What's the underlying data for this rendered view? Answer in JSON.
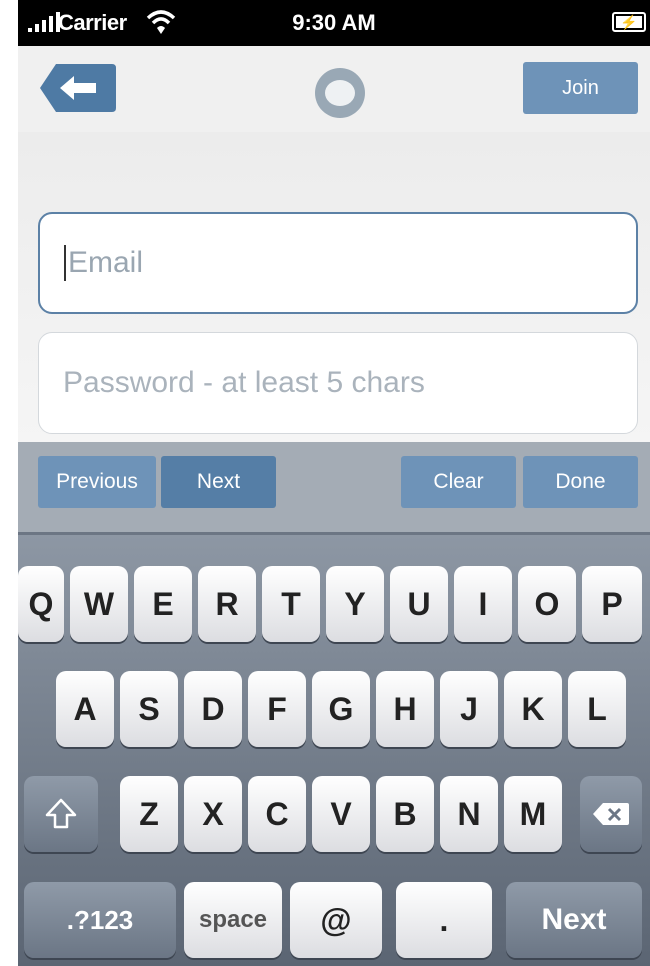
{
  "status_bar": {
    "carrier": "Carrier",
    "time": "9:30 AM",
    "signal_icon": "signal-bars-icon",
    "wifi_icon": "wifi-icon",
    "battery_icon": "battery-charging-icon"
  },
  "nav": {
    "back_icon": "back-arrow-icon",
    "logo_icon": "app-logo-icon",
    "join_label": "Join"
  },
  "form": {
    "email_placeholder": "Email",
    "email_value": "",
    "password_placeholder": "Password - at least 5 chars",
    "password_value": ""
  },
  "accessory_bar": {
    "previous": "Previous",
    "next": "Next",
    "clear": "Clear",
    "done": "Done"
  },
  "keyboard": {
    "row1": [
      "Q",
      "W",
      "E",
      "R",
      "T",
      "Y",
      "U",
      "I",
      "O",
      "P"
    ],
    "row2": [
      "A",
      "S",
      "D",
      "F",
      "G",
      "H",
      "J",
      "K",
      "L"
    ],
    "row3": [
      "Z",
      "X",
      "C",
      "V",
      "B",
      "N",
      "M"
    ],
    "shift_icon": "shift-icon",
    "delete_icon": "backspace-icon",
    "numbers_label": ".?123",
    "space_label": "space",
    "at_label": "@",
    "dot_label": ".",
    "next_label": "Next"
  },
  "colors": {
    "accent": "#6e93b8",
    "accent_dark": "#557ea6",
    "accessory_bg": "#a4acb5",
    "keyboard_bg": "#6b7584"
  }
}
